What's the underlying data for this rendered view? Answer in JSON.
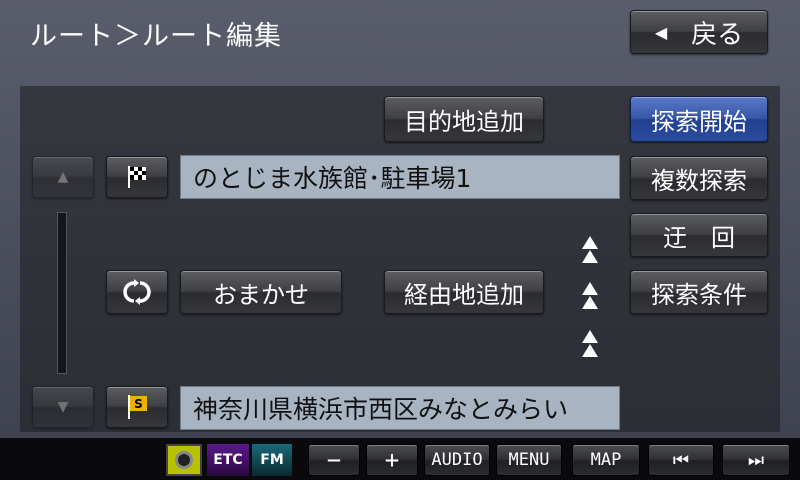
{
  "header": {
    "breadcrumb": "ルート＞ルート編集",
    "back_label": "戻る"
  },
  "buttons": {
    "add_destination": "目的地追加",
    "start_search": "探索開始",
    "multi_search": "複数探索",
    "detour": "迂　回",
    "auto": "おまかせ",
    "add_waypoint": "経由地追加",
    "search_conditions": "探索条件"
  },
  "route": {
    "destination": "のとじま水族館･駐車場1",
    "start": "神奈川県横浜市西区みなとみらい"
  },
  "icons": {
    "start_flag_letter": "S",
    "back_arrow": "◀",
    "scroll_up": "▲",
    "scroll_down": "▼",
    "auto_symbol": "()"
  },
  "status": {
    "etc": "ETC",
    "fm": "FM"
  },
  "bottom_bar": {
    "minus": "−",
    "plus": "+",
    "audio": "AUDIO",
    "menu": "MENU",
    "map": "MAP",
    "prev": "⏮",
    "next": "⏭"
  },
  "colors": {
    "accent_blue": "#3656a8",
    "field_bg": "#a9b4c2",
    "start_flag": "#e8b400"
  }
}
